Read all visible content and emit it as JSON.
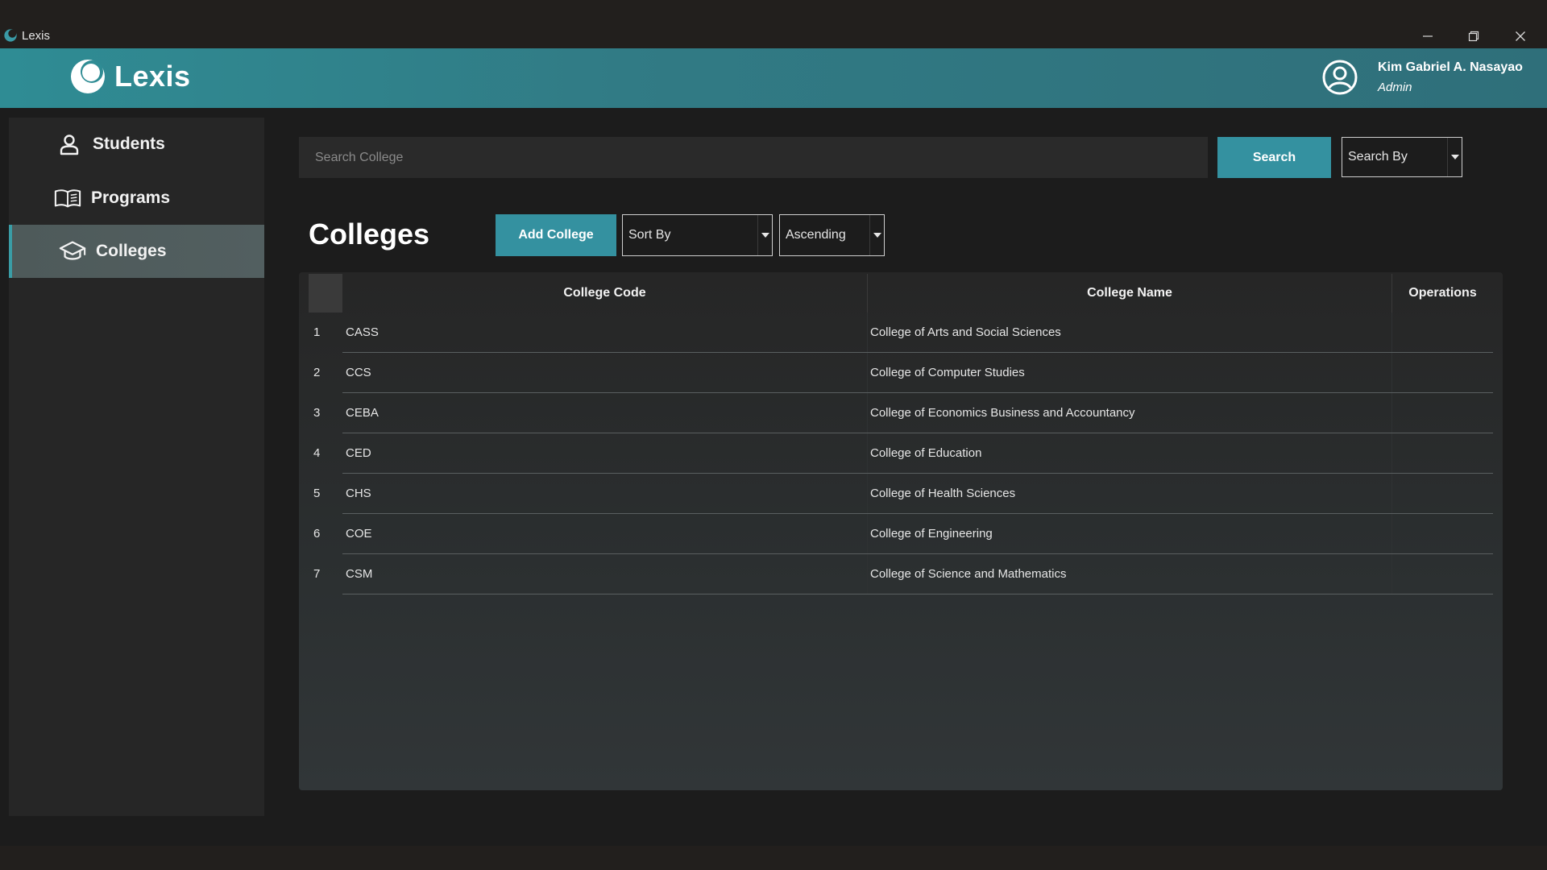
{
  "window": {
    "title": "Lexis"
  },
  "header": {
    "brand": "Lexis",
    "user_name": "Kim Gabriel A. Nasayao",
    "user_role": "Admin"
  },
  "sidebar": {
    "items": [
      {
        "label": "Students",
        "icon": "person-icon",
        "active": false
      },
      {
        "label": "Programs",
        "icon": "book-icon",
        "active": false
      },
      {
        "label": "Colleges",
        "icon": "graduation-cap-icon",
        "active": true
      }
    ]
  },
  "search": {
    "placeholder": "Search College",
    "button_label": "Search",
    "search_by": "Search By"
  },
  "main": {
    "title": "Colleges",
    "add_button": "Add College",
    "sort_by": "Sort By",
    "order": "Ascending"
  },
  "table": {
    "columns": [
      "College Code",
      "College Name",
      "Operations"
    ],
    "rows": [
      {
        "index": "1",
        "code": "CASS",
        "name": "College of Arts and Social Sciences"
      },
      {
        "index": "2",
        "code": "CCS",
        "name": "College of Computer Studies"
      },
      {
        "index": "3",
        "code": "CEBA",
        "name": "College of Economics Business and Accountancy"
      },
      {
        "index": "4",
        "code": "CED",
        "name": "College of Education"
      },
      {
        "index": "5",
        "code": "CHS",
        "name": "College of Health Sciences"
      },
      {
        "index": "6",
        "code": "COE",
        "name": "College of Engineering"
      },
      {
        "index": "7",
        "code": "CSM",
        "name": "College of Science and Mathematics"
      }
    ]
  },
  "colors": {
    "accent": "#3491a0",
    "header_start": "#2f8c94",
    "header_end": "#2f6f7a",
    "background": "#1c1c1c",
    "sidebar": "#262626"
  }
}
